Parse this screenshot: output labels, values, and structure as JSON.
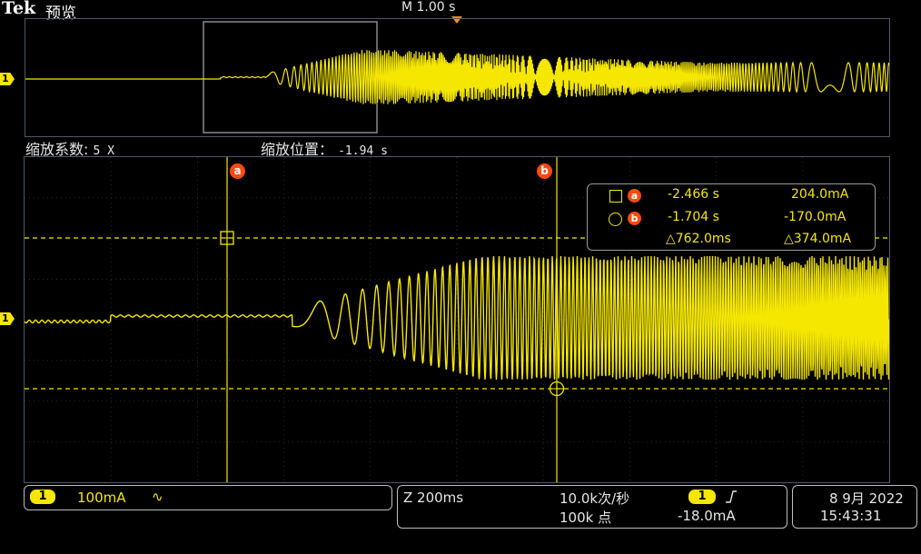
{
  "header": {
    "brand": "Tek",
    "mode": "预览",
    "timebase": "M 1.00 s"
  },
  "channel_marker_label": "1",
  "zoom_info": {
    "factor_label": "缩放系数:",
    "factor_value": "5 X",
    "position_label": "缩放位置：",
    "position_value": "-1.94 s"
  },
  "cursors": {
    "a_tag": "a",
    "b_tag": "b"
  },
  "readout": {
    "a_time": "-2.466 s",
    "a_value": "204.0mA",
    "b_time": "-1.704 s",
    "b_value": "-170.0mA",
    "delta_time": "△762.0ms",
    "delta_value": "△374.0mA"
  },
  "status": {
    "channel": "1",
    "vdiv": "100mA",
    "coupling_icon": "∿",
    "zoom_timebase": "Z 200ms",
    "sample_rate": "10.0k次/秒",
    "record_length": "100k 点",
    "trigger_channel": "1",
    "trigger_slope_icon": "rising-edge-icon",
    "trigger_level": "-18.0mA",
    "date": "8 9月 2022",
    "time": "15:43:31"
  },
  "colors": {
    "trace": "#f5e700",
    "cursor_tag": "#ff4a10",
    "trigger_marker": "#ff8a1c",
    "grid": "#3a3a3a"
  }
}
